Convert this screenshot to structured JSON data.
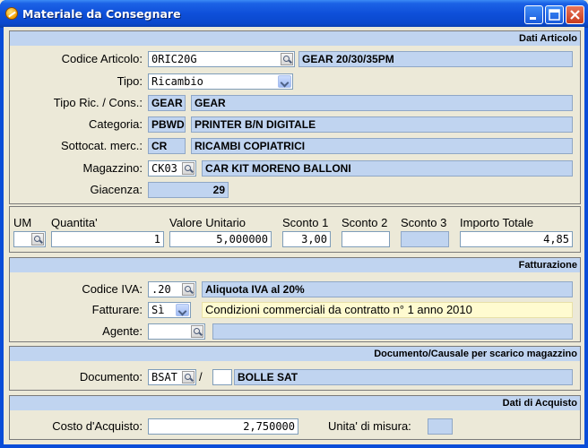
{
  "window": {
    "title": "Materiale da Consegnare"
  },
  "dati_articolo": {
    "header": "Dati Articolo",
    "codice_articolo": {
      "label": "Codice Articolo:",
      "value": "0RIC20G",
      "description": "GEAR 20/30/35PM"
    },
    "tipo": {
      "label": "Tipo:",
      "value": "Ricambio"
    },
    "tipo_ric_cons": {
      "label": "Tipo Ric. / Cons.:",
      "code": "GEAR",
      "description": "GEAR"
    },
    "categoria": {
      "label": "Categoria:",
      "code": "PBWD",
      "description": "PRINTER B/N DIGITALE"
    },
    "sottocat": {
      "label": "Sottocat. merc.:",
      "code": "CR",
      "description": "RICAMBI COPIATRICI"
    },
    "magazzino": {
      "label": "Magazzino:",
      "value": "CK03",
      "description": "CAR KIT MORENO BALLONI"
    },
    "giacenza": {
      "label": "Giacenza:",
      "value": "29"
    }
  },
  "quantities": {
    "um": {
      "label": "UM",
      "value": ""
    },
    "quantita": {
      "label": "Quantita'",
      "value": "1"
    },
    "valore_unitario": {
      "label": "Valore Unitario",
      "value": "5,000000"
    },
    "sconto1": {
      "label": "Sconto 1",
      "value": "3,00"
    },
    "sconto2": {
      "label": "Sconto 2",
      "value": ""
    },
    "sconto3": {
      "label": "Sconto 3",
      "value": ""
    },
    "importo_totale": {
      "label": "Importo Totale",
      "value": "4,85"
    }
  },
  "fatturazione": {
    "header": "Fatturazione",
    "codice_iva": {
      "label": "Codice IVA:",
      "value": ".20",
      "description": "Aliquota IVA al 20%"
    },
    "fatturare": {
      "label": "Fatturare:",
      "value": "Sì",
      "note": "Condizioni commerciali da contratto n° 1 anno 2010"
    },
    "agente": {
      "label": "Agente:",
      "value": "",
      "description": ""
    }
  },
  "documento": {
    "header": "Documento/Causale per scarico magazzino",
    "label": "Documento:",
    "value": "BSAT",
    "separator": "/",
    "causale": "",
    "description": "BOLLE SAT"
  },
  "acquisto": {
    "header": "Dati di Acquisto",
    "costo": {
      "label": "Costo d'Acquisto:",
      "value": "2,750000"
    },
    "unita": {
      "label": "Unita' di misura:",
      "value": ""
    }
  },
  "icons": {
    "app": "app-icon",
    "lookup": "magnifier-icon",
    "dropdown": "chevron-down-icon"
  }
}
